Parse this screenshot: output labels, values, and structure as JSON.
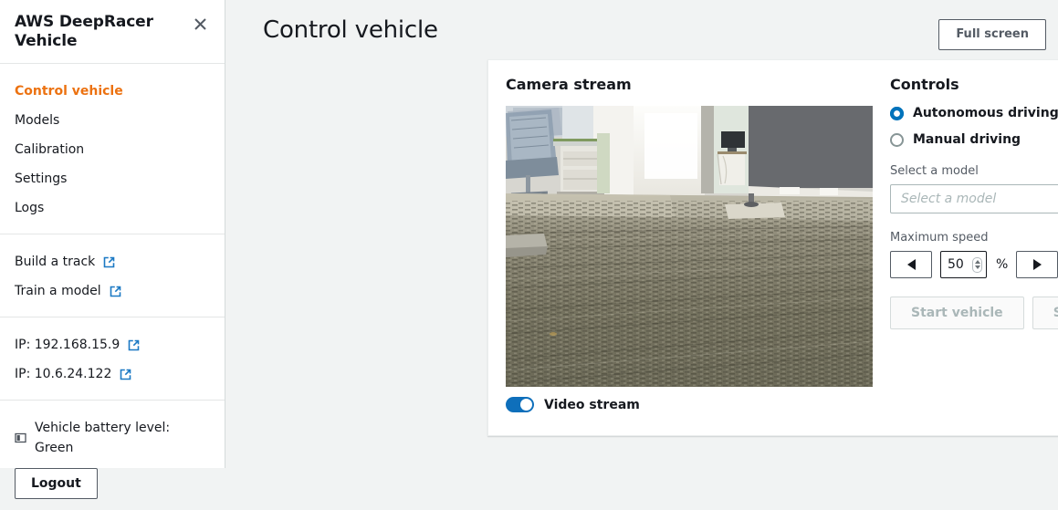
{
  "sidebar": {
    "title": "AWS DeepRacer Vehicle",
    "close_icon": "close-icon",
    "nav_items": [
      {
        "label": "Control vehicle",
        "active": true
      },
      {
        "label": "Models",
        "active": false
      },
      {
        "label": "Calibration",
        "active": false
      },
      {
        "label": "Settings",
        "active": false
      },
      {
        "label": "Logs",
        "active": false
      }
    ],
    "external_links": [
      {
        "label": "Build a track",
        "icon": "external-link-icon"
      },
      {
        "label": "Train a model",
        "icon": "external-link-icon"
      }
    ],
    "ip_links": [
      {
        "label": "IP: 192.168.15.9",
        "icon": "external-link-icon"
      },
      {
        "label": "IP: 10.6.24.122",
        "icon": "external-link-icon"
      }
    ],
    "battery": {
      "icon": "battery-icon",
      "label": "Vehicle battery level: Green"
    },
    "logout_label": "Logout"
  },
  "header": {
    "title": "Control vehicle",
    "fullscreen_label": "Full screen"
  },
  "camera": {
    "section_title": "Camera stream",
    "video_stream_label": "Video stream",
    "video_stream_on": true
  },
  "controls": {
    "section_title": "Controls",
    "driving_modes": [
      {
        "label": "Autonomous driving",
        "selected": true
      },
      {
        "label": "Manual driving",
        "selected": false
      }
    ],
    "model": {
      "label": "Select a model",
      "placeholder": "Select a model",
      "value": ""
    },
    "speed": {
      "label": "Maximum speed",
      "value": "50",
      "unit": "%",
      "decrement_icon": "triangle-left-icon",
      "increment_icon": "triangle-right-icon"
    },
    "start_label": "Start vehicle",
    "stop_label": "Stop vehicle"
  },
  "colors": {
    "accent_orange": "#ec7211",
    "link_blue": "#0073bb",
    "toggle_blue": "#0e6fbb",
    "page_bg": "#f1f3f3"
  }
}
